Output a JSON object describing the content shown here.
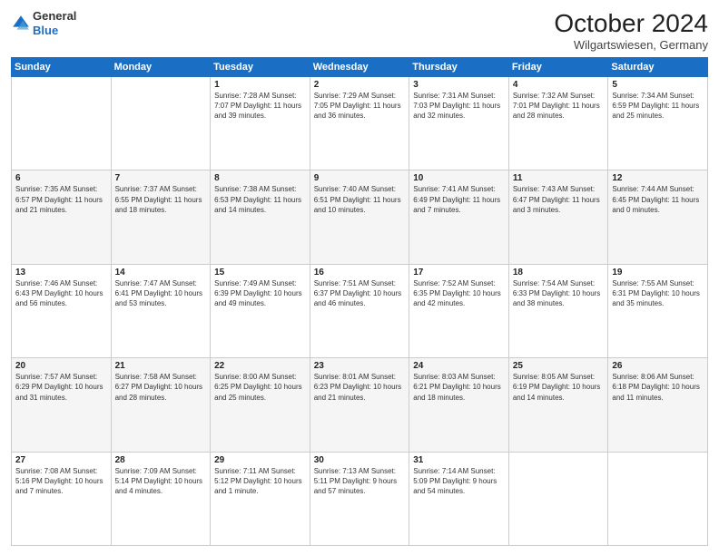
{
  "header": {
    "logo": {
      "line1": "General",
      "line2": "Blue"
    },
    "title": "October 2024",
    "subtitle": "Wilgartswiesen, Germany"
  },
  "days_of_week": [
    "Sunday",
    "Monday",
    "Tuesday",
    "Wednesday",
    "Thursday",
    "Friday",
    "Saturday"
  ],
  "weeks": [
    [
      {
        "day": "",
        "info": ""
      },
      {
        "day": "",
        "info": ""
      },
      {
        "day": "1",
        "info": "Sunrise: 7:28 AM\nSunset: 7:07 PM\nDaylight: 11 hours and 39 minutes."
      },
      {
        "day": "2",
        "info": "Sunrise: 7:29 AM\nSunset: 7:05 PM\nDaylight: 11 hours and 36 minutes."
      },
      {
        "day": "3",
        "info": "Sunrise: 7:31 AM\nSunset: 7:03 PM\nDaylight: 11 hours and 32 minutes."
      },
      {
        "day": "4",
        "info": "Sunrise: 7:32 AM\nSunset: 7:01 PM\nDaylight: 11 hours and 28 minutes."
      },
      {
        "day": "5",
        "info": "Sunrise: 7:34 AM\nSunset: 6:59 PM\nDaylight: 11 hours and 25 minutes."
      }
    ],
    [
      {
        "day": "6",
        "info": "Sunrise: 7:35 AM\nSunset: 6:57 PM\nDaylight: 11 hours and 21 minutes."
      },
      {
        "day": "7",
        "info": "Sunrise: 7:37 AM\nSunset: 6:55 PM\nDaylight: 11 hours and 18 minutes."
      },
      {
        "day": "8",
        "info": "Sunrise: 7:38 AM\nSunset: 6:53 PM\nDaylight: 11 hours and 14 minutes."
      },
      {
        "day": "9",
        "info": "Sunrise: 7:40 AM\nSunset: 6:51 PM\nDaylight: 11 hours and 10 minutes."
      },
      {
        "day": "10",
        "info": "Sunrise: 7:41 AM\nSunset: 6:49 PM\nDaylight: 11 hours and 7 minutes."
      },
      {
        "day": "11",
        "info": "Sunrise: 7:43 AM\nSunset: 6:47 PM\nDaylight: 11 hours and 3 minutes."
      },
      {
        "day": "12",
        "info": "Sunrise: 7:44 AM\nSunset: 6:45 PM\nDaylight: 11 hours and 0 minutes."
      }
    ],
    [
      {
        "day": "13",
        "info": "Sunrise: 7:46 AM\nSunset: 6:43 PM\nDaylight: 10 hours and 56 minutes."
      },
      {
        "day": "14",
        "info": "Sunrise: 7:47 AM\nSunset: 6:41 PM\nDaylight: 10 hours and 53 minutes."
      },
      {
        "day": "15",
        "info": "Sunrise: 7:49 AM\nSunset: 6:39 PM\nDaylight: 10 hours and 49 minutes."
      },
      {
        "day": "16",
        "info": "Sunrise: 7:51 AM\nSunset: 6:37 PM\nDaylight: 10 hours and 46 minutes."
      },
      {
        "day": "17",
        "info": "Sunrise: 7:52 AM\nSunset: 6:35 PM\nDaylight: 10 hours and 42 minutes."
      },
      {
        "day": "18",
        "info": "Sunrise: 7:54 AM\nSunset: 6:33 PM\nDaylight: 10 hours and 38 minutes."
      },
      {
        "day": "19",
        "info": "Sunrise: 7:55 AM\nSunset: 6:31 PM\nDaylight: 10 hours and 35 minutes."
      }
    ],
    [
      {
        "day": "20",
        "info": "Sunrise: 7:57 AM\nSunset: 6:29 PM\nDaylight: 10 hours and 31 minutes."
      },
      {
        "day": "21",
        "info": "Sunrise: 7:58 AM\nSunset: 6:27 PM\nDaylight: 10 hours and 28 minutes."
      },
      {
        "day": "22",
        "info": "Sunrise: 8:00 AM\nSunset: 6:25 PM\nDaylight: 10 hours and 25 minutes."
      },
      {
        "day": "23",
        "info": "Sunrise: 8:01 AM\nSunset: 6:23 PM\nDaylight: 10 hours and 21 minutes."
      },
      {
        "day": "24",
        "info": "Sunrise: 8:03 AM\nSunset: 6:21 PM\nDaylight: 10 hours and 18 minutes."
      },
      {
        "day": "25",
        "info": "Sunrise: 8:05 AM\nSunset: 6:19 PM\nDaylight: 10 hours and 14 minutes."
      },
      {
        "day": "26",
        "info": "Sunrise: 8:06 AM\nSunset: 6:18 PM\nDaylight: 10 hours and 11 minutes."
      }
    ],
    [
      {
        "day": "27",
        "info": "Sunrise: 7:08 AM\nSunset: 5:16 PM\nDaylight: 10 hours and 7 minutes."
      },
      {
        "day": "28",
        "info": "Sunrise: 7:09 AM\nSunset: 5:14 PM\nDaylight: 10 hours and 4 minutes."
      },
      {
        "day": "29",
        "info": "Sunrise: 7:11 AM\nSunset: 5:12 PM\nDaylight: 10 hours and 1 minute."
      },
      {
        "day": "30",
        "info": "Sunrise: 7:13 AM\nSunset: 5:11 PM\nDaylight: 9 hours and 57 minutes."
      },
      {
        "day": "31",
        "info": "Sunrise: 7:14 AM\nSunset: 5:09 PM\nDaylight: 9 hours and 54 minutes."
      },
      {
        "day": "",
        "info": ""
      },
      {
        "day": "",
        "info": ""
      }
    ]
  ]
}
